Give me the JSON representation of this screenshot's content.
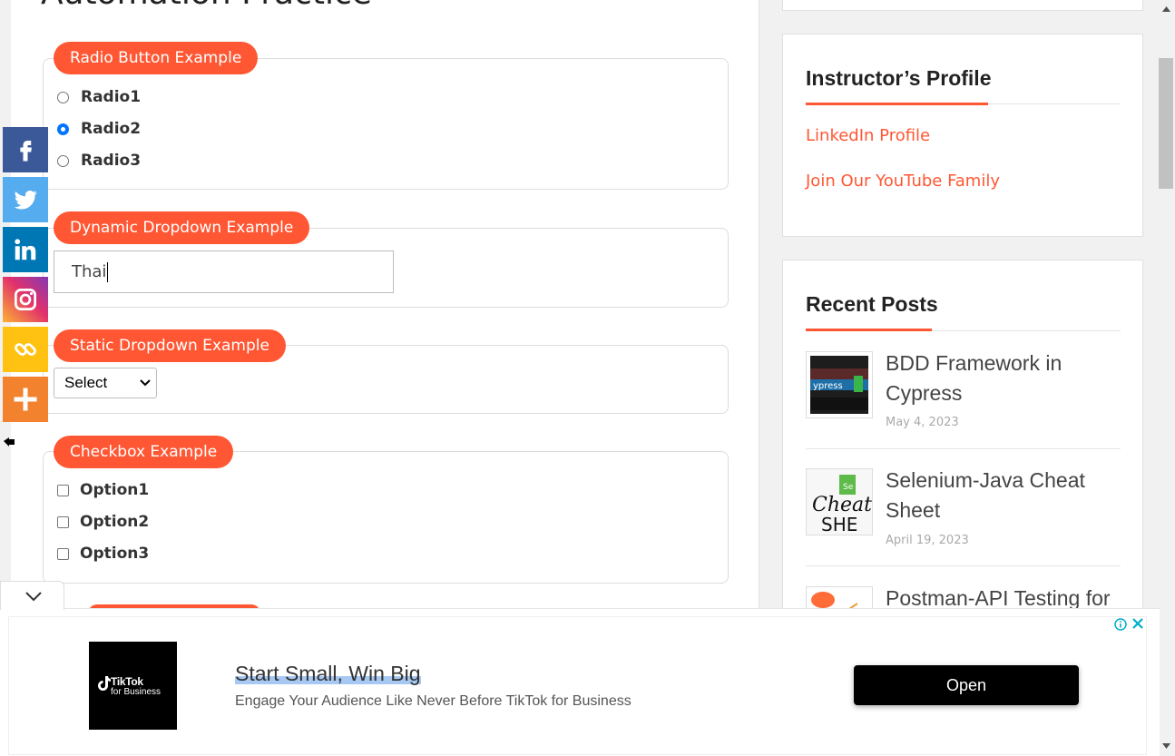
{
  "page": {
    "title": "Automation Practice"
  },
  "radio": {
    "legend": "Radio Button Example",
    "options": [
      "Radio1",
      "Radio2",
      "Radio3"
    ],
    "selected": "Radio2"
  },
  "dynamic_dropdown": {
    "legend": "Dynamic Dropdown Example",
    "value": "Thai"
  },
  "static_dropdown": {
    "legend": "Static Dropdown Example",
    "selected": "Select"
  },
  "checkbox": {
    "legend": "Checkbox Example",
    "options": [
      "Option1",
      "Option2",
      "Option3"
    ]
  },
  "share": {
    "items": [
      {
        "icon": "facebook-icon",
        "color": "#3b5998"
      },
      {
        "icon": "twitter-icon",
        "color": "#55acee"
      },
      {
        "icon": "linkedin-icon",
        "color": "#0077b5"
      },
      {
        "icon": "instagram-icon",
        "color": "#d6249f"
      },
      {
        "icon": "link-icon",
        "color": "#ffc112"
      },
      {
        "icon": "more-icon",
        "color": "#f2822d"
      }
    ],
    "hide_icon": "hand-point-left-icon"
  },
  "sidebar": {
    "instructor": {
      "title": "Instructor’s Profile",
      "links": [
        "LinkedIn Profile",
        "Join Our YouTube Family"
      ]
    },
    "recent_posts": {
      "title": "Recent Posts",
      "posts": [
        {
          "title": "BDD Framework in Cypress",
          "date": "May 4, 2023"
        },
        {
          "title": "Selenium-Java Cheat Sheet",
          "date": "April 19, 2023"
        },
        {
          "title": "Postman-API Testing for"
        }
      ]
    }
  },
  "ad": {
    "brand_name": "TikTok",
    "brand_sub": "for Business",
    "headline": "Start Small, Win Big",
    "description": "Engage Your Audience Like Never Before TikTok for Business",
    "cta": "Open",
    "accent": "#00aecd"
  },
  "colors": {
    "accent": "#ff5733",
    "link": "#ff5733"
  }
}
